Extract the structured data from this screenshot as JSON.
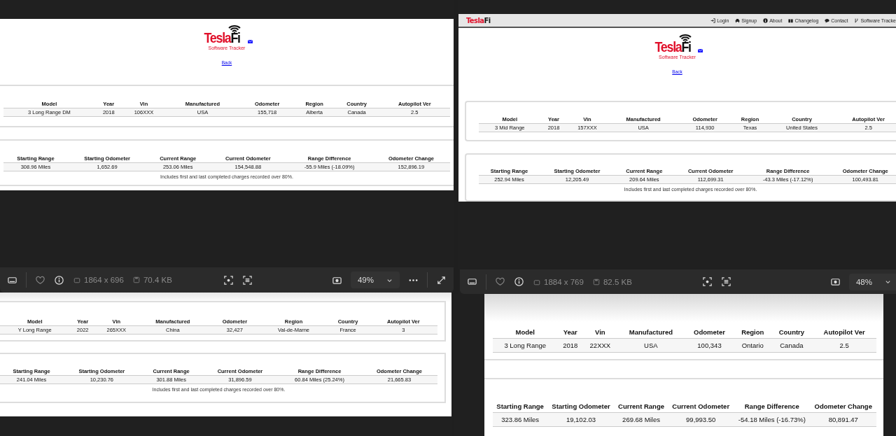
{
  "windows": [
    {
      "header": {
        "brand_red": "Tesla",
        "brand_black": "Fi",
        "subtitle": "Software Tracker"
      },
      "back_link": "Back",
      "vehicle_table": {
        "columns": [
          "Model",
          "Year",
          "Vin",
          "Manufactured",
          "Odometer",
          "Region",
          "Country",
          "Autopilot Ver"
        ],
        "rows": [
          [
            "3 Long Range DM",
            "2018",
            "106XXX",
            "USA",
            "155,718",
            "Alberta",
            "Canada",
            "2.5"
          ]
        ]
      },
      "range_table": {
        "columns": [
          "Starting Range",
          "Starting Odometer",
          "Current Range",
          "Current Odometer",
          "Range Difference",
          "Odometer Change"
        ],
        "rows": [
          [
            "308.96 Miles",
            "1,652.69",
            "253.06 Miles",
            "154,548.88",
            "-55.9 Miles (-18.09%)",
            "152,896.19"
          ]
        ]
      },
      "footnote": "Includes first and last completed charges recorded over 80%.",
      "toolbar": {
        "dimensions": "1864 x 696",
        "file_size": "70.4 KB",
        "zoom": "49%"
      }
    },
    {
      "navbar": {
        "brand_red": "Tesla",
        "brand_black": "Fi",
        "items": [
          {
            "kind": "login",
            "label": "Login"
          },
          {
            "kind": "signup",
            "label": "Signup"
          },
          {
            "kind": "about",
            "label": "About"
          },
          {
            "kind": "changelog",
            "label": "Changelog"
          },
          {
            "kind": "contact",
            "label": "Contact"
          },
          {
            "kind": "tracker",
            "label": "Software Tracke"
          }
        ]
      },
      "header": {
        "brand_red": "Tesla",
        "brand_black": "Fi",
        "subtitle": "Software Tracker"
      },
      "back_link": "Back",
      "vehicle_table": {
        "columns": [
          "Model",
          "Year",
          "Vin",
          "Manufactured",
          "Odometer",
          "Region",
          "Country",
          "Autopilot Ver"
        ],
        "rows": [
          [
            "3 Mid Range",
            "2018",
            "157XXX",
            "USA",
            "114,930",
            "Texas",
            "United States",
            "2.5"
          ]
        ]
      },
      "range_table": {
        "columns": [
          "Starting Range",
          "Starting Odometer",
          "Current Range",
          "Current Odometer",
          "Range Difference",
          "Odometer Change"
        ],
        "rows": [
          [
            "252.94 Miles",
            "12,205.49",
            "209.64 Miles",
            "112,699.31",
            "-43.3 Miles (-17.12%)",
            "100,493.81"
          ]
        ]
      },
      "footnote": "Includes first and last completed charges recorded over 80%.",
      "toolbar": {
        "dimensions": "1884 x 769",
        "file_size": "82.5 KB",
        "zoom": "48%"
      }
    },
    {
      "vehicle_table": {
        "columns": [
          "Model",
          "Year",
          "Vin",
          "Manufactured",
          "Odometer",
          "Region",
          "Country",
          "Autopilot Ver"
        ],
        "rows": [
          [
            "Y Long Range",
            "2022",
            "265XXX",
            "China",
            "32,427",
            "Val-de-Marne",
            "France",
            "3"
          ]
        ]
      },
      "range_table": {
        "columns": [
          "Starting Range",
          "Starting Odometer",
          "Current Range",
          "Current Odometer",
          "Range Difference",
          "Odometer Change"
        ],
        "rows": [
          [
            "241.04 Miles",
            "10,230.76",
            "301.88 Miles",
            "31,896.59",
            "60.84 Miles (25.24%)",
            "21,665.83"
          ]
        ]
      },
      "footnote": "Includes first and last completed charges recorded over 80%."
    },
    {
      "vehicle_table": {
        "columns": [
          "Model",
          "Year",
          "Vin",
          "Manufactured",
          "Odometer",
          "Region",
          "Country",
          "Autopilot Ver"
        ],
        "rows": [
          [
            "3 Long Range",
            "2018",
            "22XXX",
            "USA",
            "100,343",
            "Ontario",
            "Canada",
            "2.5"
          ]
        ]
      },
      "range_table": {
        "columns": [
          "Starting Range",
          "Starting Odometer",
          "Current Range",
          "Current Odometer",
          "Range Difference",
          "Odometer Change"
        ],
        "rows": [
          [
            "323.86 Miles",
            "19,102.03",
            "269.68 Miles",
            "99,993.50",
            "-54.18 Miles (-16.73%)",
            "80,891.47"
          ]
        ]
      }
    }
  ]
}
